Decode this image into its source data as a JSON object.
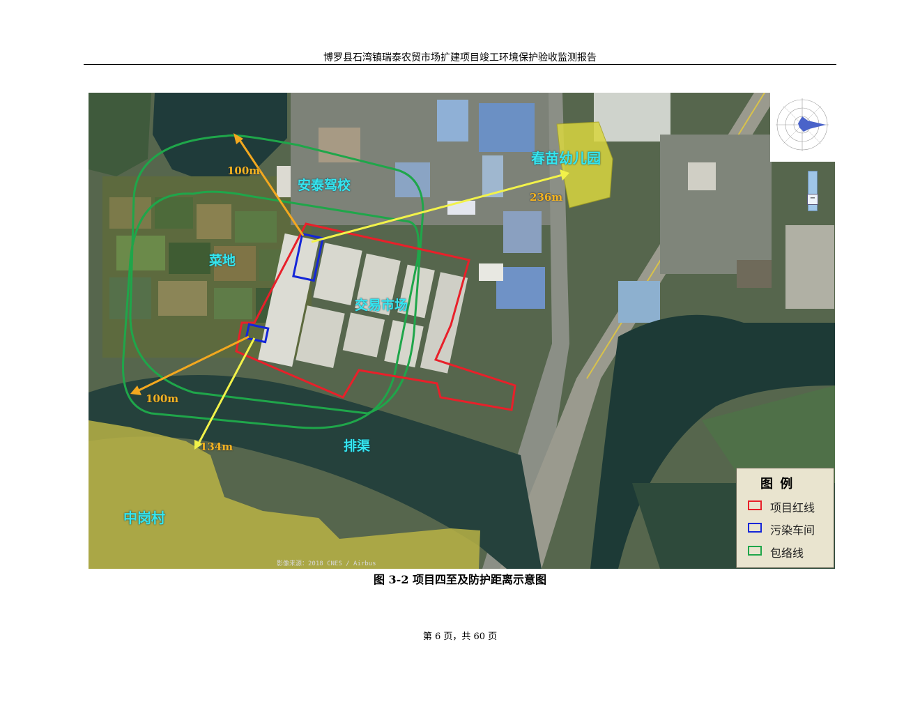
{
  "header": {
    "title": "博罗县石湾镇瑞泰农贸市场扩建项目竣工环境保护验收监测报告"
  },
  "map": {
    "labels": {
      "kindergarten": "春苗幼儿园",
      "driving_school": "安泰驾校",
      "farmland": "菜地",
      "market": "交易市场",
      "drain": "排渠",
      "village": "中岗村"
    },
    "distances": {
      "north": "100m",
      "southwest": "100m",
      "kindergarten": "236m",
      "village": "134m"
    },
    "image_credit": "影像来源：2018 CNES / Airbus",
    "zoom_minus": "−"
  },
  "legend": {
    "title": "图  例",
    "items": [
      {
        "label": "项目红线",
        "color": "#e8202a"
      },
      {
        "label": "污染车间",
        "color": "#1426d8"
      },
      {
        "label": "包络线",
        "color": "#1fa64a"
      }
    ]
  },
  "caption": "图 3-2  项目四至及防护距离示意图",
  "footer": {
    "page": "第 6 页，共 60 页"
  }
}
